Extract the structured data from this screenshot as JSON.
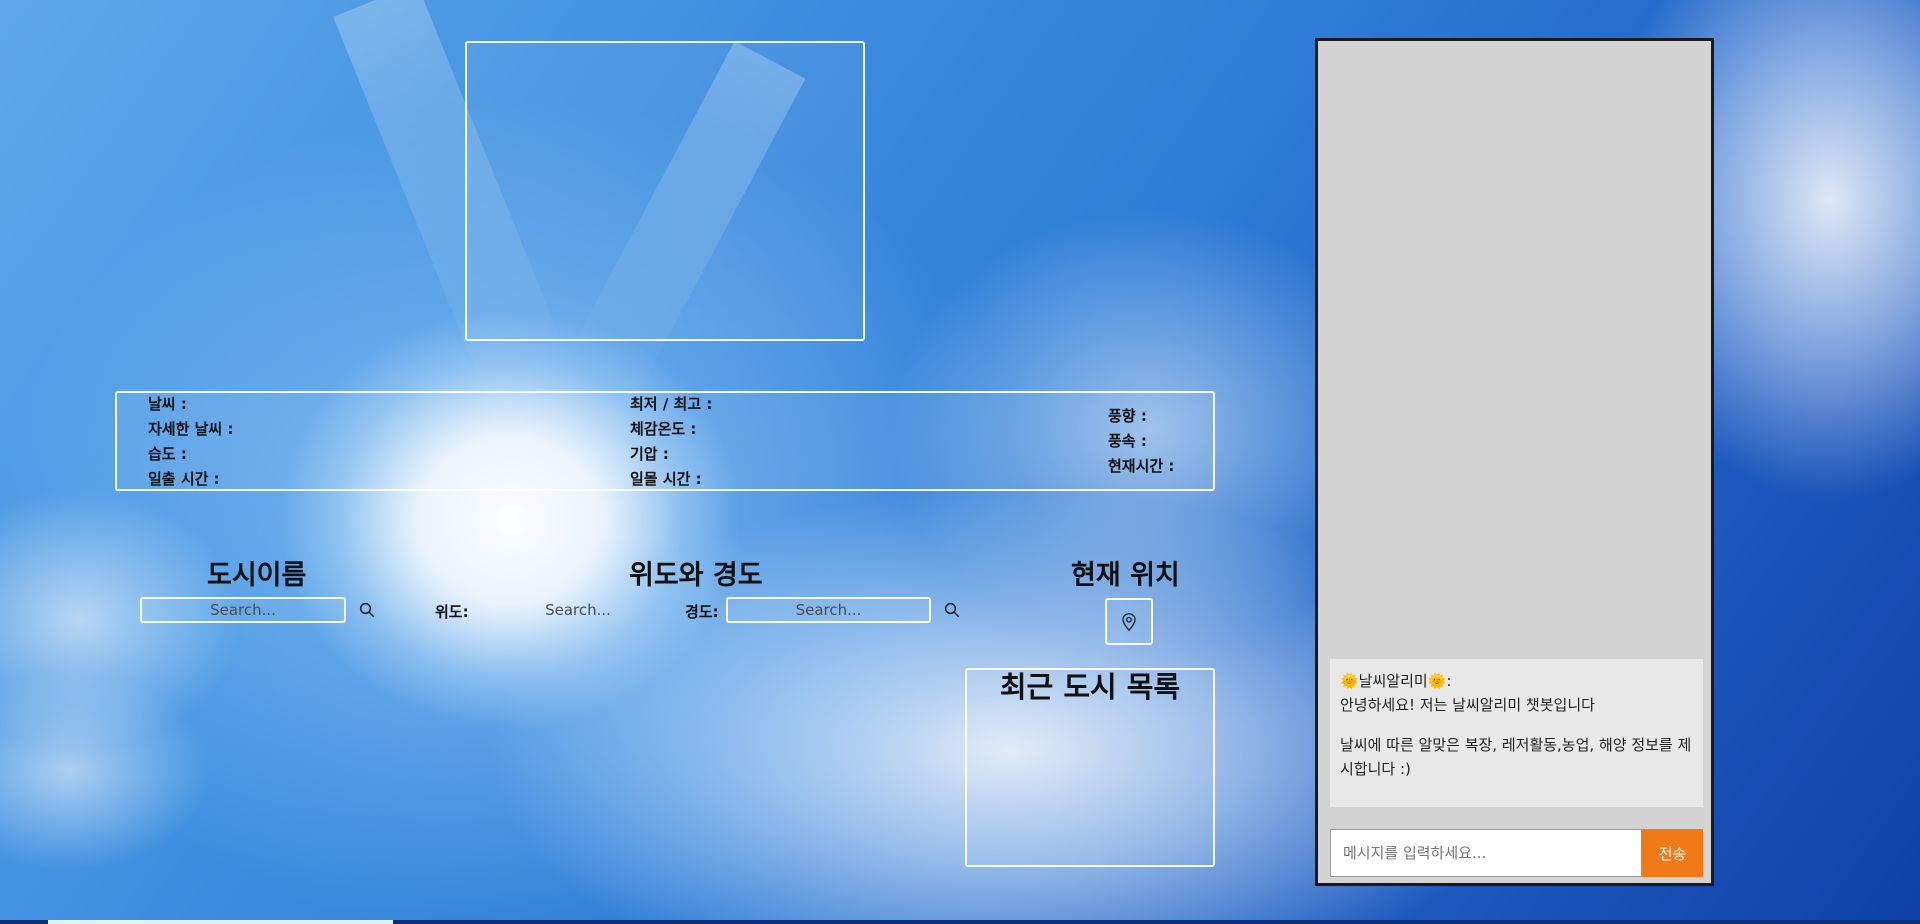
{
  "weather_info": {
    "col1": [
      "날씨 :",
      "자세한 날씨 :",
      "습도 :",
      "일출 시간 :"
    ],
    "col2": [
      "최저 / 최고 :",
      "체감온도 :",
      "기압 :",
      "일몰 시간 :"
    ],
    "col3": [
      "풍향 :",
      "풍속 :",
      "현재시간 :"
    ]
  },
  "city_search": {
    "title": "도시이름",
    "placeholder": "Search..."
  },
  "coord_search": {
    "title": "위도와 경도",
    "lat_label": "위도:",
    "lat_placeholder": "Search...",
    "lon_label": "경도:",
    "lon_placeholder": "Search..."
  },
  "current_location": {
    "title": "현재 위치"
  },
  "recent_cities": {
    "title": "최근 도시 목록"
  },
  "chatbot": {
    "bot_name": "🌞날씨알리미🌞:",
    "greeting": "안녕하세요! 저는 날씨알리미 챗봇입니다",
    "description": "날씨에 따른 알맞은 복장, 레저활동,농업, 해양 정보를 제시합니다 :)",
    "input_placeholder": "메시지를 입력하세요...",
    "send_label": "전송"
  },
  "colors": {
    "send_button": "#f07b16",
    "chat_panel": "#d3d3d3",
    "chat_message": "#e8e8e8"
  }
}
